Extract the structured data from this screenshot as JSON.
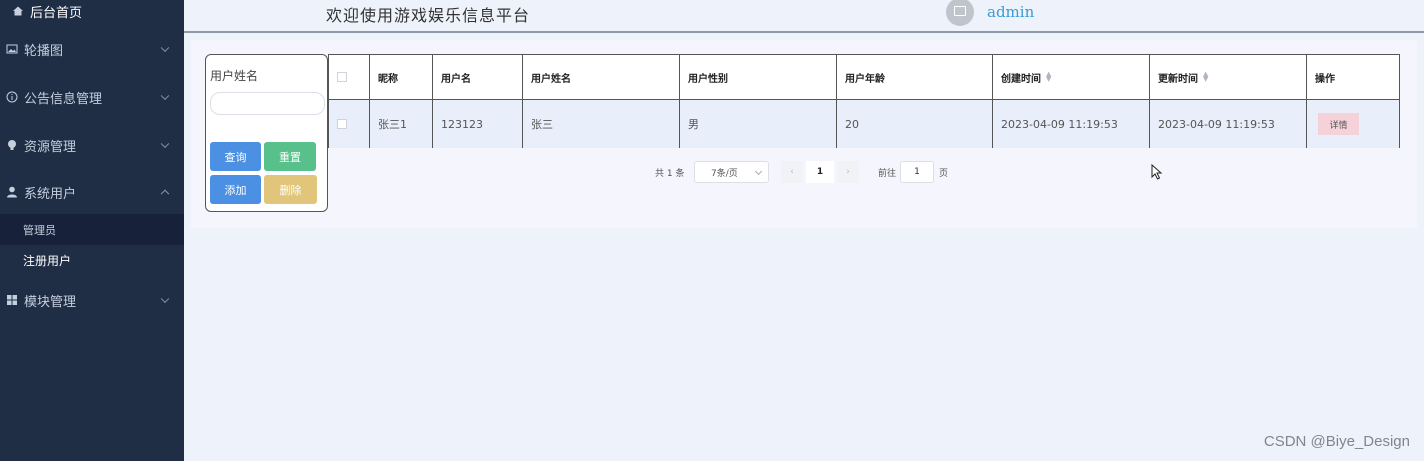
{
  "sidebar": {
    "home": "后台首页",
    "menus": [
      {
        "label": "轮播图"
      },
      {
        "label": "公告信息管理"
      },
      {
        "label": "资源管理"
      },
      {
        "label": "系统用户"
      },
      {
        "label": "模块管理"
      }
    ],
    "submenu": [
      {
        "label": "管理员"
      },
      {
        "label": "注册用户"
      }
    ]
  },
  "header": {
    "welcome": "欢迎使用游戏娱乐信息平台",
    "username": "admin"
  },
  "search": {
    "label": "用户姓名",
    "value": "",
    "query": "查询",
    "reset": "重置",
    "add": "添加",
    "delete": "删除"
  },
  "table": {
    "columns": [
      "昵称",
      "用户名",
      "用户姓名",
      "用户性别",
      "用户年龄",
      "创建时间",
      "更新时间",
      "操作"
    ],
    "rows": [
      {
        "nickname": "张三1",
        "username": "123123",
        "realname": "张三",
        "gender": "男",
        "age": "20",
        "created": "2023-04-09 11:19:53",
        "updated": "2023-04-09 11:19:53",
        "action": "详情"
      }
    ]
  },
  "pagination": {
    "total": "共 1 条",
    "page_size": "7条/页",
    "current": "1",
    "goto_label": "前往",
    "jump_value": "1",
    "page_label": "页"
  },
  "watermark": "CSDN @Biye_Design",
  "colors": {
    "sidebar": "#1f2d45",
    "query": "#4b90e2",
    "reset": "#58c08a",
    "add": "#4b90e2",
    "delete": "#e0c57a",
    "detail": "#f5d2da"
  }
}
